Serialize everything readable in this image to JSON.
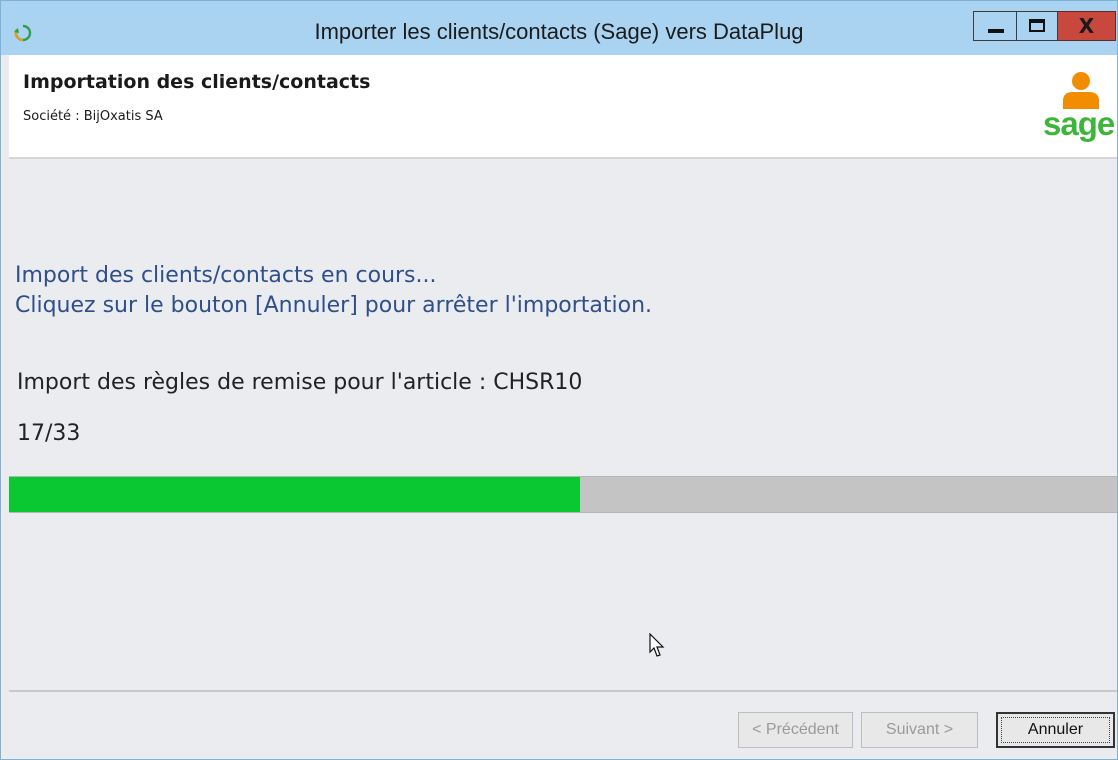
{
  "window": {
    "title": "Importer les clients/contacts (Sage) vers DataPlug",
    "controls": [
      "minimize",
      "maximize",
      "close"
    ],
    "close_glyph": "X"
  },
  "header": {
    "title": "Importation des clients/contacts",
    "subtitle": "Société : BijOxatis SA",
    "logo_text": "sage",
    "logo_color": "#3db53a",
    "person_icon_color": "#f28c00"
  },
  "body": {
    "message_line1": "Import des clients/contacts en cours...",
    "message_line2": "Cliquez sur le bouton [Annuler] pour arrêter l'importation.",
    "detail_line": "Import des règles de remise pour l'article : CHSR10",
    "counter": "17/33",
    "progress": {
      "current": 17,
      "total": 33,
      "fill_color": "#0ac832",
      "track_color": "#c4c4c4"
    }
  },
  "footer": {
    "prev_label": "< Précédent",
    "next_label": "Suivant >",
    "cancel_label": "Annuler"
  },
  "colors": {
    "titlebar": "#a9d3f1",
    "close_button": "#c9483d",
    "message_text": "#2f4f8a"
  }
}
